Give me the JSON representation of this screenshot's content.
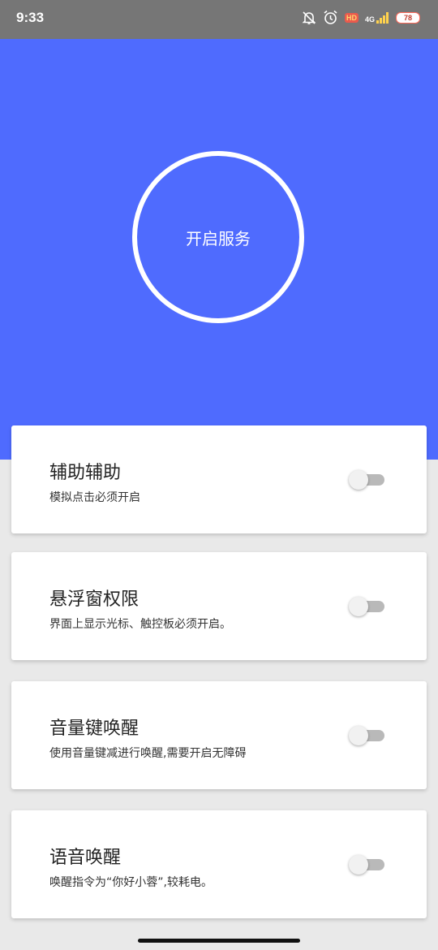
{
  "status_bar": {
    "time": "9:33",
    "network": "4G",
    "hd_badge": "HD",
    "battery": "78",
    "icons": [
      "bell-off-icon",
      "alarm-icon",
      "hd-icon",
      "signal-icon",
      "battery-icon"
    ]
  },
  "hero": {
    "background_color": "#4f6bfe",
    "service_button_label": "开启服务"
  },
  "settings": [
    {
      "title": "辅助辅助",
      "description": "模拟点击必须开启",
      "enabled": false
    },
    {
      "title": "悬浮窗权限",
      "description": "界面上显示光标、触控板必须开启。",
      "enabled": false
    },
    {
      "title": "音量键唤醒",
      "description": "使用音量键减进行唤醒,需要开启无障碍",
      "enabled": false
    },
    {
      "title": "语音唤醒",
      "description": "唤醒指令为“你好小蓉”,较耗电。",
      "enabled": false
    }
  ]
}
